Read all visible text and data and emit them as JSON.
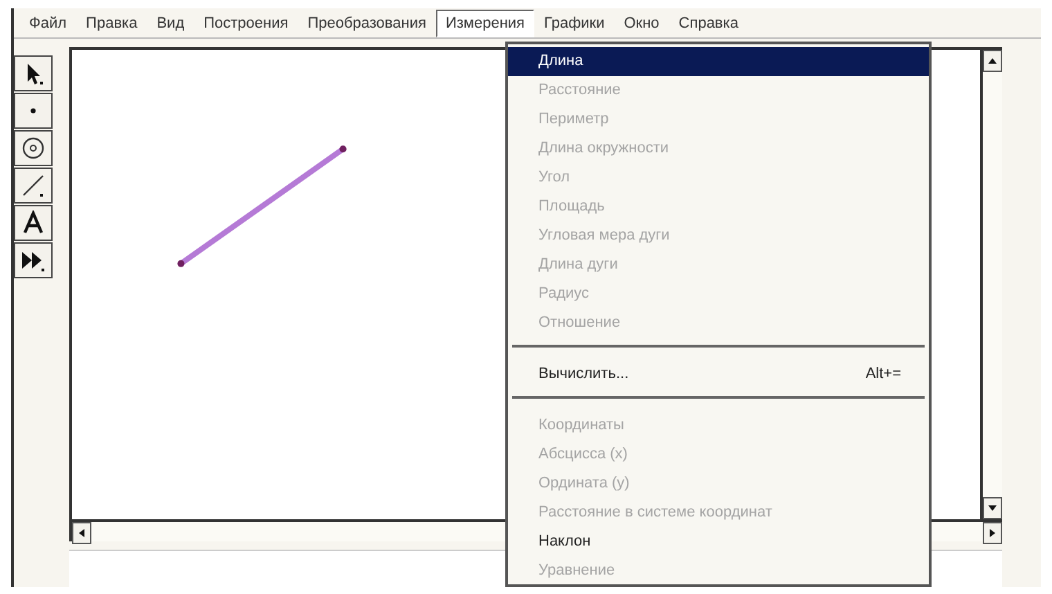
{
  "menubar": [
    {
      "label": "Файл",
      "selected": false
    },
    {
      "label": "Правка",
      "selected": false
    },
    {
      "label": "Вид",
      "selected": false
    },
    {
      "label": "Построения",
      "selected": false
    },
    {
      "label": "Преобразования",
      "selected": false
    },
    {
      "label": "Измерения",
      "selected": true
    },
    {
      "label": "Графики",
      "selected": false
    },
    {
      "label": "Окно",
      "selected": false
    },
    {
      "label": "Справка",
      "selected": false
    }
  ],
  "tools": [
    {
      "kind": "arrow"
    },
    {
      "kind": "point"
    },
    {
      "kind": "compass"
    },
    {
      "kind": "line"
    },
    {
      "kind": "text"
    },
    {
      "kind": "custom"
    }
  ],
  "menu": [
    {
      "kind": "item",
      "label": "Длина",
      "selected": true,
      "disabled": false
    },
    {
      "kind": "item",
      "label": "Расстояние",
      "selected": false,
      "disabled": true
    },
    {
      "kind": "item",
      "label": "Периметр",
      "selected": false,
      "disabled": true
    },
    {
      "kind": "item",
      "label": "Длина окружности",
      "selected": false,
      "disabled": true
    },
    {
      "kind": "item",
      "label": "Угол",
      "selected": false,
      "disabled": true
    },
    {
      "kind": "item",
      "label": "Площадь",
      "selected": false,
      "disabled": true
    },
    {
      "kind": "item",
      "label": "Угловая мера дуги",
      "selected": false,
      "disabled": true
    },
    {
      "kind": "item",
      "label": "Длина дуги",
      "selected": false,
      "disabled": true
    },
    {
      "kind": "item",
      "label": "Радиус",
      "selected": false,
      "disabled": true
    },
    {
      "kind": "item",
      "label": "Отношение",
      "selected": false,
      "disabled": true
    },
    {
      "kind": "separator"
    },
    {
      "kind": "item",
      "label": "Вычислить...",
      "shortcut": "Alt+=",
      "selected": false,
      "disabled": false
    },
    {
      "kind": "separator"
    },
    {
      "kind": "item",
      "label": "Координаты",
      "selected": false,
      "disabled": true
    },
    {
      "kind": "item",
      "label": "Абсцисса (x)",
      "selected": false,
      "disabled": true
    },
    {
      "kind": "item",
      "label": "Ордината (y)",
      "selected": false,
      "disabled": true
    },
    {
      "kind": "item",
      "label": "Расстояние в системе координат",
      "selected": false,
      "disabled": true
    },
    {
      "kind": "item",
      "label": "Наклон",
      "selected": false,
      "disabled": false
    },
    {
      "kind": "item",
      "label": "Уравнение",
      "selected": false,
      "disabled": true
    }
  ]
}
